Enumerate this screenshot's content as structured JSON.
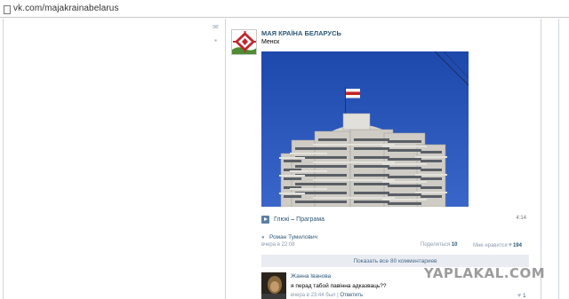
{
  "browser": {
    "url": "vk.com/majakrainabelarus"
  },
  "sidebar": {
    "icons": [
      "mail-icon",
      "comment-icon"
    ]
  },
  "post": {
    "author": "МАЯ КРАЇНА БЕЛАРУСЬ",
    "text": "Менск",
    "audio": {
      "artist": "Глюкі",
      "separator": " – ",
      "title": "Праграма",
      "duration": "4:14"
    },
    "signer": "Роман Тумилович",
    "date": "вчера в 22:08",
    "share_label": "Поделиться",
    "share_count": "10",
    "like_label": "Мне нравится",
    "like_count": "194",
    "colors": {
      "link": "#2b587a",
      "sky": "#2a54b8",
      "flag_red": "#c42222"
    }
  },
  "comments": {
    "show_all_label": "Показать все 80 комментариев",
    "items": [
      {
        "author": "Жанна Іванова",
        "text": "я перад табой павінна адказваць??",
        "meta": "вчера в 23:44 был",
        "reply_label": "Ответить",
        "likes": "1"
      }
    ]
  },
  "watermark": "YAPLAKAL.COM"
}
